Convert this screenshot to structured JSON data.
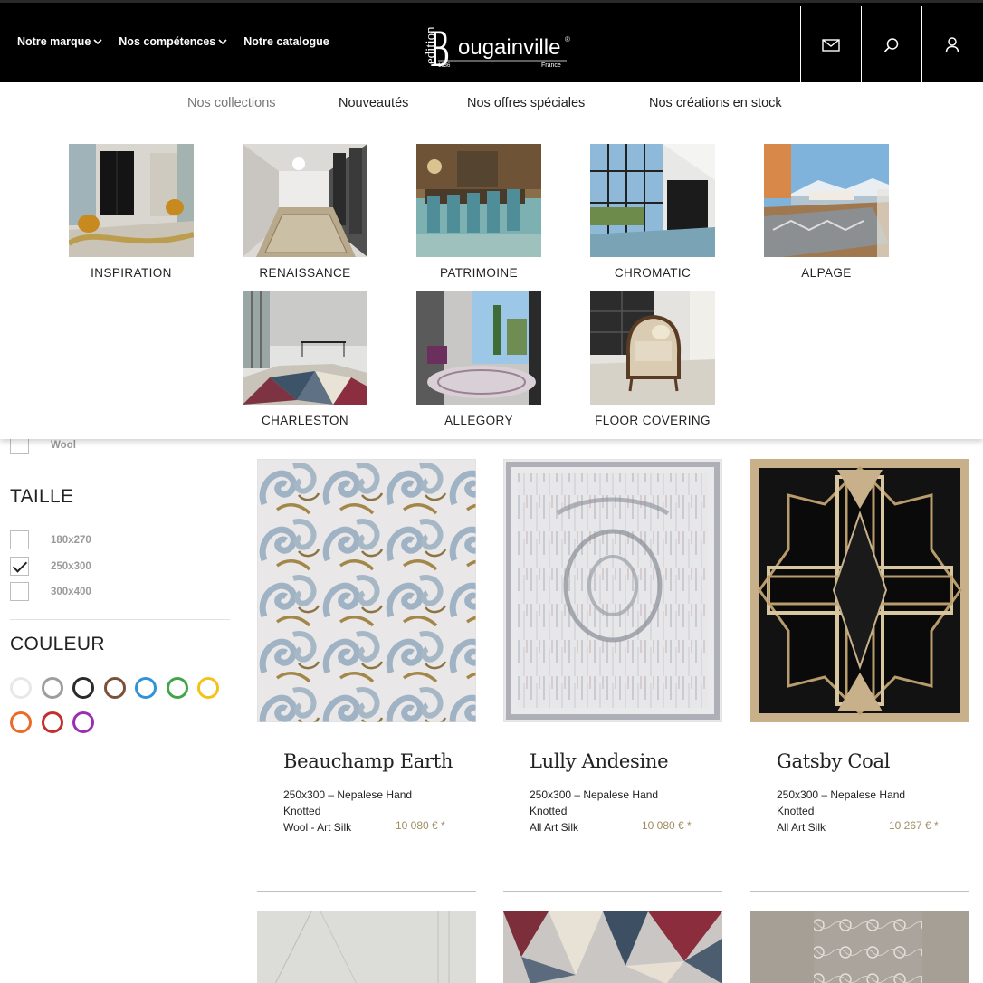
{
  "header": {
    "nav": [
      {
        "label": "Notre marque",
        "has_dropdown": true
      },
      {
        "label": "Nos compétences",
        "has_dropdown": true
      },
      {
        "label": "Notre catalogue",
        "has_dropdown": false
      }
    ],
    "logo": {
      "prefix": "edition",
      "name": "Bougainville",
      "year": "1936",
      "country": "France",
      "mark": "®"
    },
    "icons": [
      "mail-icon",
      "search-icon",
      "user-icon"
    ]
  },
  "mega_menu": {
    "tabs": [
      "Nos collections",
      "Nouveautés",
      "Nos offres spéciales",
      "Nos créations en stock"
    ],
    "active_tab": "Nos collections",
    "collections": [
      "INSPIRATION",
      "RENAISSANCE",
      "PATRIMOINE",
      "CHROMATIC",
      "ALPAGE",
      "CHARLESTON",
      "ALLEGORY",
      "FLOOR COVERING"
    ]
  },
  "filters": {
    "matiere_partial": {
      "label": "Wool",
      "checked": false
    },
    "taille": {
      "title": "TAILLE",
      "options": [
        {
          "label": "180x270",
          "checked": false
        },
        {
          "label": "250x300",
          "checked": true
        },
        {
          "label": "300x400",
          "checked": false
        }
      ]
    },
    "couleur": {
      "title": "COULEUR",
      "colors": [
        "#e8e8e8",
        "#9e9e9e",
        "#2b2b2b",
        "#7a5138",
        "#2f95d8",
        "#43a54a",
        "#f2c21b",
        "#ec6a2c",
        "#c32e2e",
        "#9a2fb3"
      ]
    }
  },
  "products": [
    {
      "name": "Beauchamp Earth",
      "line1": "250x300 – Nepalese Hand",
      "line2": "Knotted",
      "material": "Wool - Art Silk",
      "price": "10 080 € *"
    },
    {
      "name": "Lully Andesine",
      "line1": "250x300 – Nepalese Hand",
      "line2": "Knotted",
      "material": "All Art Silk",
      "price": "10 080 € *"
    },
    {
      "name": "Gatsby Coal",
      "line1": "250x300 – Nepalese Hand",
      "line2": "Knotted",
      "material": "All Art Silk",
      "price": "10 267 € *"
    }
  ]
}
